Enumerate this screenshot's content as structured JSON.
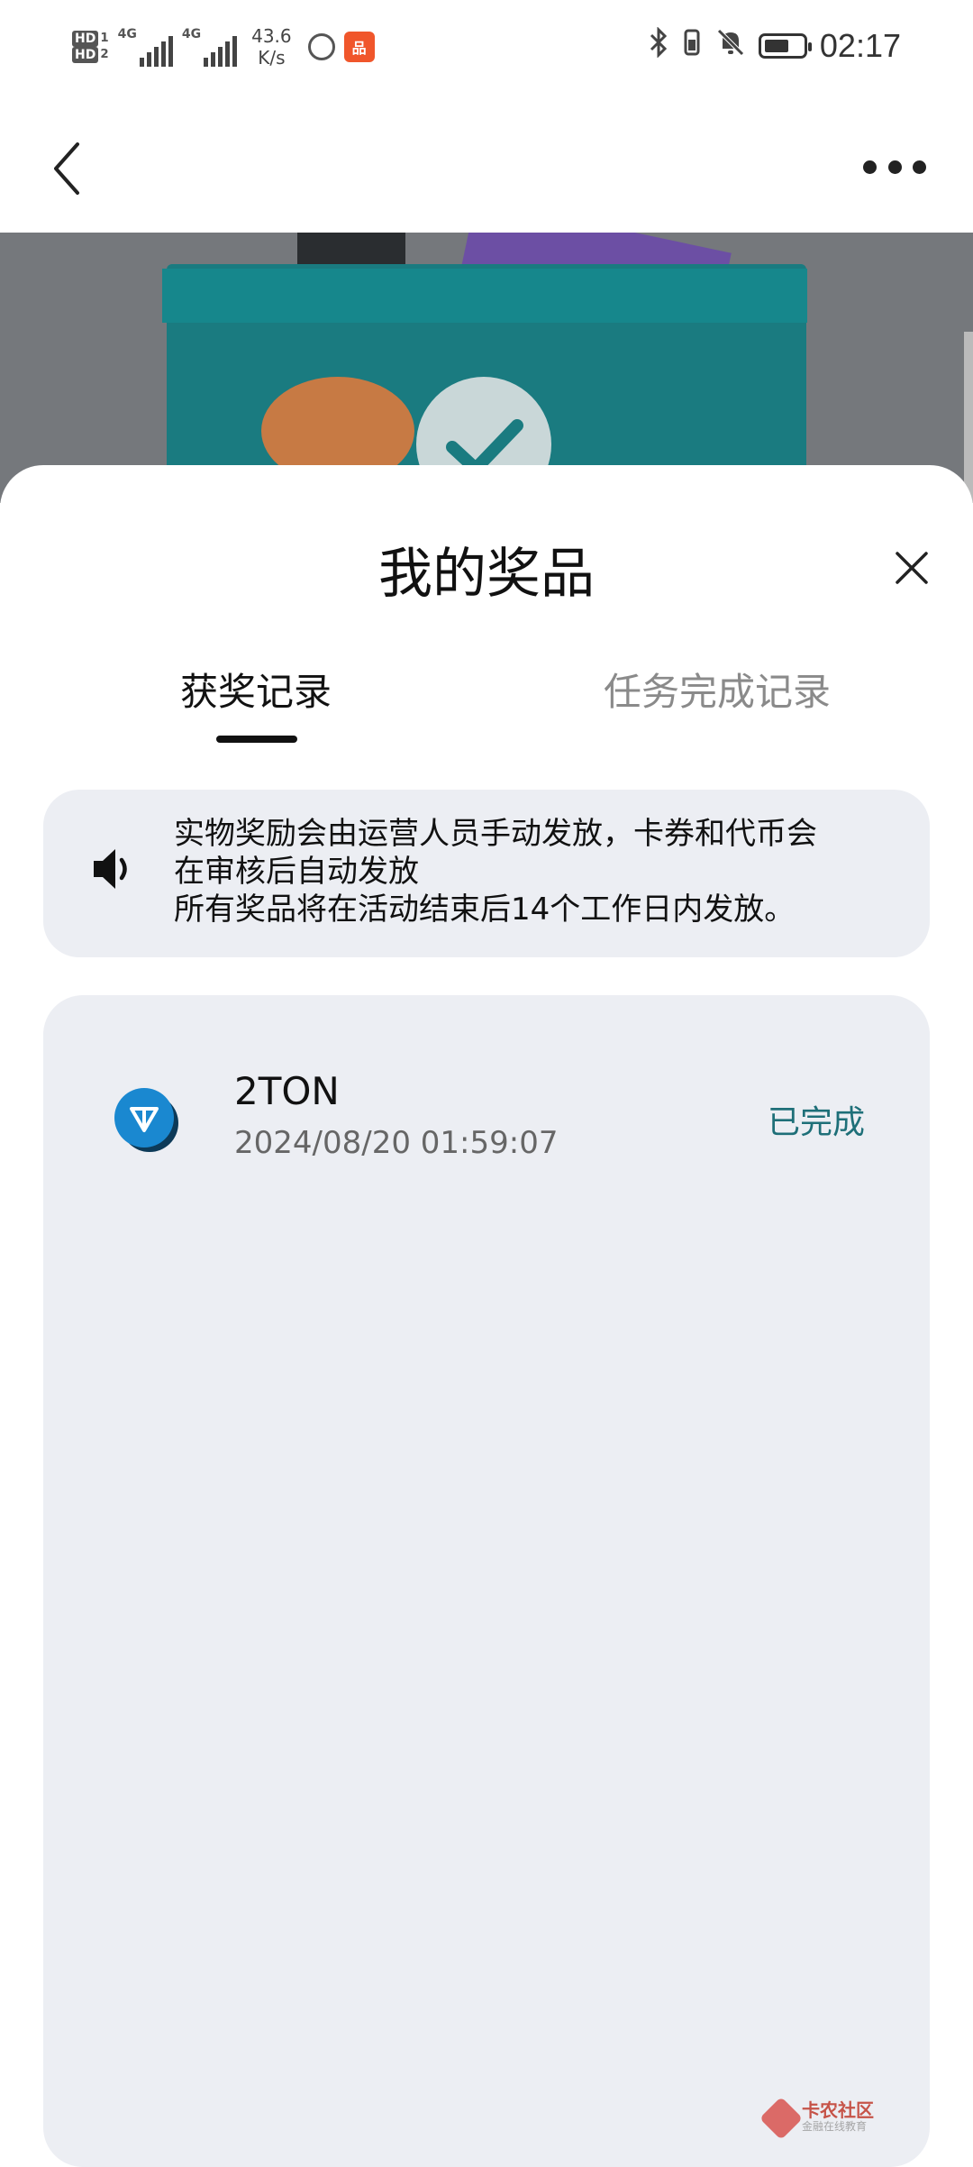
{
  "status_bar": {
    "sim1": "HD",
    "sim1_index": "1",
    "sim2": "HD",
    "sim2_index": "2",
    "network1": "4G",
    "network2": "4G",
    "speed_value": "43.6",
    "speed_unit": "K/s",
    "app_badge_text": "品",
    "time": "02:17",
    "icons": [
      "bluetooth-icon",
      "vibrate-icon",
      "mute-bell-icon",
      "battery-icon"
    ]
  },
  "nav": {
    "back_icon": "chevron-left-icon",
    "more_icon": "more-dots-icon"
  },
  "sheet": {
    "title": "我的奖品",
    "tabs": [
      {
        "label": "获奖记录",
        "active": true
      },
      {
        "label": "任务完成记录",
        "active": false
      }
    ],
    "notice": {
      "icon": "speaker-icon",
      "lines": [
        "实物奖励会由运营人员手动发放，卡券和代币会",
        "在审核后自动发放",
        "所有奖品将在活动结束后14个工作日内发放。"
      ]
    },
    "prizes": [
      {
        "name": "2TON",
        "time": "2024/08/20 01:59:07",
        "status": "已完成",
        "icon": "ton-coin-icon"
      }
    ]
  },
  "watermark": {
    "title": "卡农社区",
    "subtitle": "金融在线教育"
  },
  "colors": {
    "status_teal": "#1e6f78",
    "panel_bg": "#eceef3",
    "hero_bg": "#75787c",
    "ton_blue": "#1a88d0"
  }
}
